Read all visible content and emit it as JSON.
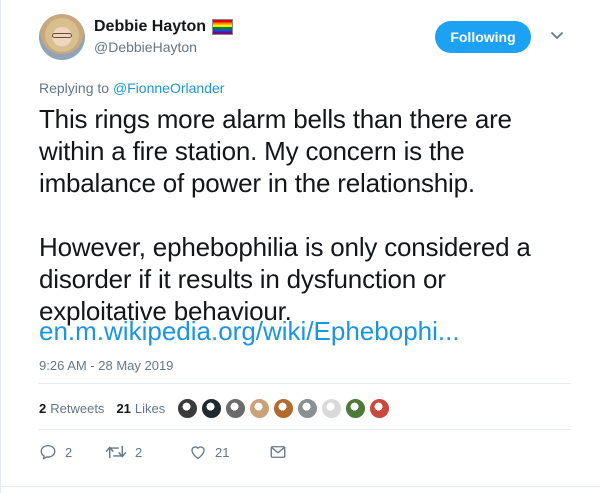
{
  "author": {
    "display_name": "Debbie Hayton",
    "handle": "@DebbieHayton",
    "badge_icon": "rainbow-flag-icon"
  },
  "follow_button": {
    "label": "Following",
    "color": "#1da1f2"
  },
  "reply_context": {
    "prefix": "Replying to",
    "mention": "@FionneOrlander"
  },
  "tweet": {
    "text": "This rings more alarm bells than there are\nwithin a fire station. My concern is the\nimbalance of power in the relationship.\n\nHowever, ephebophilia is only considered a\ndisorder if it results in dysfunction or\nexploitative behaviour.",
    "link": "en.m.wikipedia.org/wiki/Ephebophi...",
    "timestamp": "9:26 AM - 28 May 2019"
  },
  "stats": {
    "retweets_count": "2",
    "retweets_label": "Retweets",
    "likes_count": "21",
    "likes_label": "Likes",
    "liker_avatars": [
      "#3a3a3a",
      "#1e2a2f",
      "#6b6b6b",
      "#c9a27a",
      "#b36a2e",
      "#8a8f94",
      "#d9d9d9",
      "#4d7a3a",
      "#c94a3c"
    ]
  },
  "actions": {
    "reply_count": "2",
    "retweet_count": "2",
    "like_count": "21"
  },
  "colors": {
    "link": "#1b95e0",
    "muted": "#657786",
    "text": "#14171a",
    "divider": "#e6ecf0"
  }
}
